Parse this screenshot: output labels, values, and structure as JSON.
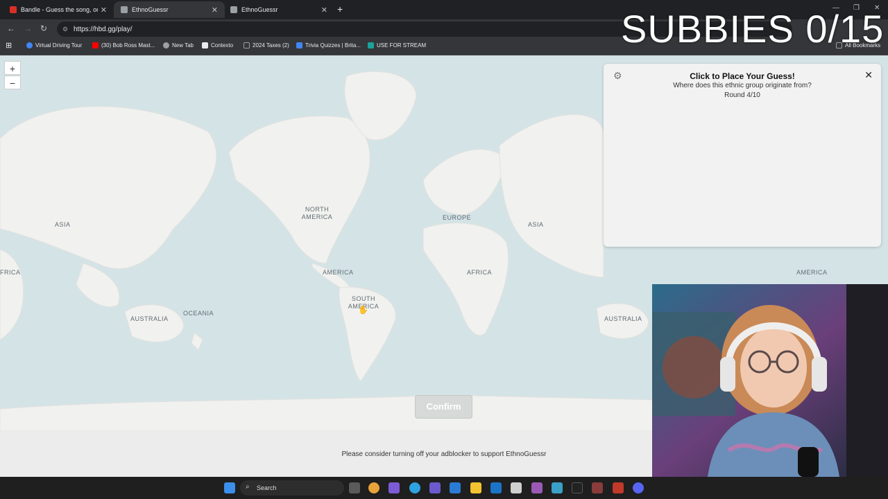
{
  "browser": {
    "tabs": [
      {
        "title": "Bandle - Guess the song, one in",
        "active": false,
        "favicon_color": "#d93025"
      },
      {
        "title": "EthnoGuessr",
        "active": true,
        "favicon_color": "#9aa0a6"
      },
      {
        "title": "EthnoGuessr",
        "active": false,
        "favicon_color": "#9aa0a6"
      }
    ],
    "url": "https://hbd.gg/play/",
    "bookmarks": [
      {
        "label": "Virtual Driving Tour",
        "icon_color": "#4285f4"
      },
      {
        "label": "(30) Bob Ross Mast...",
        "icon_color": "#ff0000"
      },
      {
        "label": "New Tab",
        "icon_color": "#9aa0a6"
      },
      {
        "label": "Contexto",
        "icon_color": "#e8eaed"
      },
      {
        "label": "2024 Taxes (2)",
        "icon_color": "#9aa0a6"
      },
      {
        "label": "Trivia Quizzes | Brita...",
        "icon_color": "#4285f4"
      },
      {
        "label": "USE FOR STREAM",
        "icon_color": "#1aa39a"
      }
    ],
    "all_bookmarks": "All Bookmarks"
  },
  "overlay": {
    "subbies": "SUBBIES 0/15"
  },
  "map": {
    "zoom_in": "+",
    "zoom_out": "−",
    "labels": {
      "asia_left": "ASIA",
      "north_america": "NORTH AMERICA",
      "europe": "EUROPE",
      "asia_right": "ASIA",
      "africa_left": "FRICA",
      "america_center": "AMERICA",
      "africa": "AFRICA",
      "america_right": "AMERICA",
      "south_america": "SOUTH AMERICA",
      "australia_left": "AUSTRALIA",
      "oceania": "OCEANIA",
      "australia_right": "AUSTRALIA"
    },
    "ocean_color": "#d4e3e6",
    "land_color": "#f1f1ef"
  },
  "panel": {
    "title": "Click to Place Your Guess!",
    "subtitle": "Where does this ethnic group originate from?",
    "round": "Round 4/10",
    "close": "✕",
    "settings_icon": "gear-icon"
  },
  "confirm_label": "Confirm",
  "ad_notice": "Please consider turning off your adblocker to support EthnoGuessr",
  "taskbar": {
    "search_label": "Search"
  }
}
